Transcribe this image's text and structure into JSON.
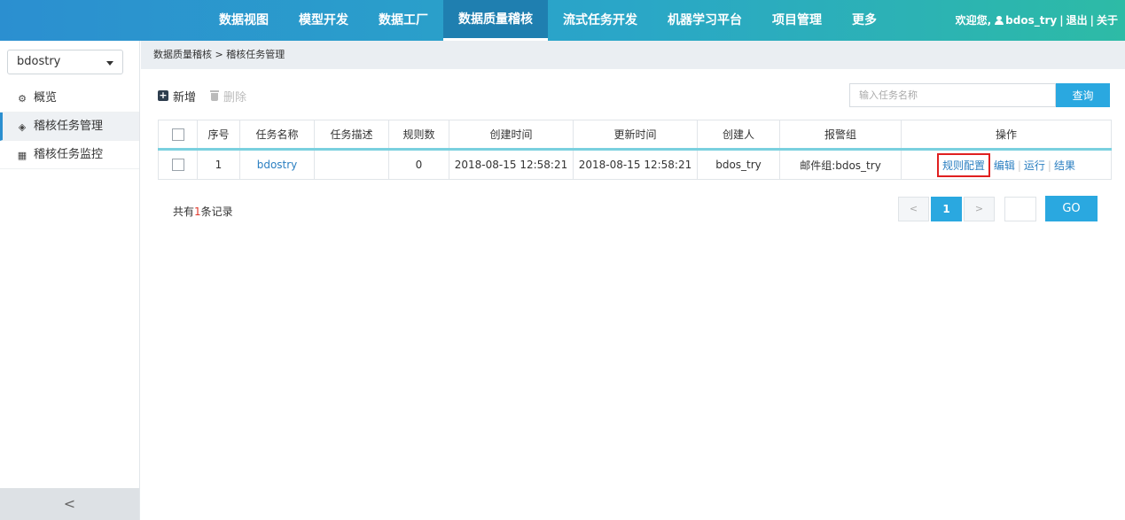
{
  "nav": {
    "items": [
      {
        "label": "数据视图"
      },
      {
        "label": "模型开发"
      },
      {
        "label": "数据工厂"
      },
      {
        "label": "数据质量稽核"
      },
      {
        "label": "流式任务开发"
      },
      {
        "label": "机器学习平台"
      },
      {
        "label": "项目管理"
      },
      {
        "label": "更多"
      }
    ],
    "active_index": 3
  },
  "user": {
    "welcome": "欢迎您,",
    "name": "bdos_try",
    "logout": "退出",
    "about": "关于",
    "separator": "|"
  },
  "sidebar": {
    "project": "bdostry",
    "items": [
      {
        "label": "概览",
        "icon": "cogs-icon"
      },
      {
        "label": "稽核任务管理",
        "icon": "cube-icon"
      },
      {
        "label": "稽核任务监控",
        "icon": "grid-icon"
      }
    ],
    "collapse_glyph": "<"
  },
  "breadcrumb": "数据质量稽核 > 稽核任务管理",
  "toolbar": {
    "add_label": "新增",
    "delete_label": "删除"
  },
  "search": {
    "placeholder": "输入任务名称",
    "button": "查询"
  },
  "table": {
    "headers": [
      "序号",
      "任务名称",
      "任务描述",
      "规则数",
      "创建时间",
      "更新时间",
      "创建人",
      "报警组",
      "操作"
    ],
    "rows": [
      {
        "index": "1",
        "name": "bdostry",
        "desc": "",
        "rules": "0",
        "created": "2018-08-15 12:58:21",
        "updated": "2018-08-15 12:58:21",
        "creator": "bdos_try",
        "alarm": "邮件组:bdos_try",
        "ops": [
          "规则配置",
          "编辑",
          "运行",
          "结果"
        ]
      }
    ]
  },
  "records": {
    "prefix": "共有",
    "count": "1",
    "suffix": "条记录"
  },
  "pager": {
    "prev": "<",
    "current": "1",
    "next": ">",
    "go": "GO"
  },
  "colors": {
    "accent": "#2aa8e0",
    "highlight": "#e02020"
  }
}
